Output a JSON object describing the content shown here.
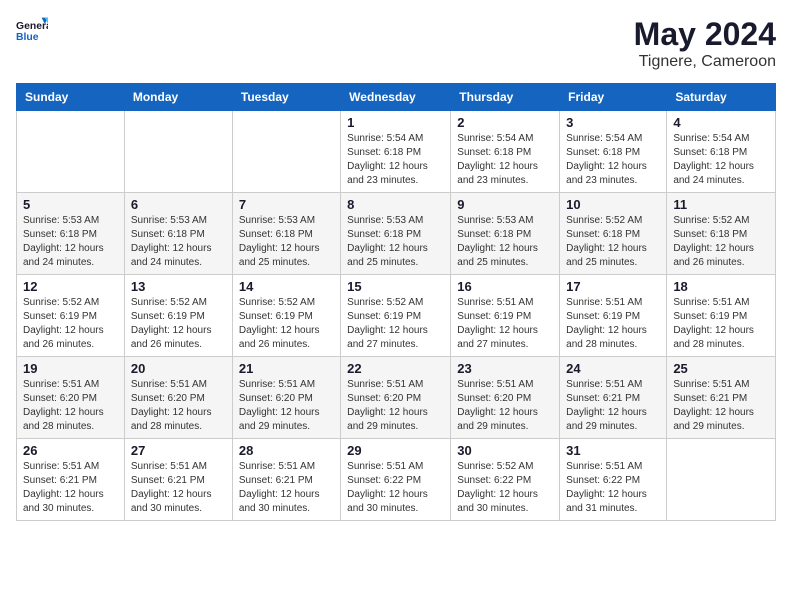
{
  "header": {
    "logo_line1": "General",
    "logo_line2": "Blue",
    "month_year": "May 2024",
    "location": "Tignere, Cameroon"
  },
  "days_of_week": [
    "Sunday",
    "Monday",
    "Tuesday",
    "Wednesday",
    "Thursday",
    "Friday",
    "Saturday"
  ],
  "weeks": [
    [
      {
        "day": "",
        "info": ""
      },
      {
        "day": "",
        "info": ""
      },
      {
        "day": "",
        "info": ""
      },
      {
        "day": "1",
        "info": "Sunrise: 5:54 AM\nSunset: 6:18 PM\nDaylight: 12 hours\nand 23 minutes."
      },
      {
        "day": "2",
        "info": "Sunrise: 5:54 AM\nSunset: 6:18 PM\nDaylight: 12 hours\nand 23 minutes."
      },
      {
        "day": "3",
        "info": "Sunrise: 5:54 AM\nSunset: 6:18 PM\nDaylight: 12 hours\nand 23 minutes."
      },
      {
        "day": "4",
        "info": "Sunrise: 5:54 AM\nSunset: 6:18 PM\nDaylight: 12 hours\nand 24 minutes."
      }
    ],
    [
      {
        "day": "5",
        "info": "Sunrise: 5:53 AM\nSunset: 6:18 PM\nDaylight: 12 hours\nand 24 minutes."
      },
      {
        "day": "6",
        "info": "Sunrise: 5:53 AM\nSunset: 6:18 PM\nDaylight: 12 hours\nand 24 minutes."
      },
      {
        "day": "7",
        "info": "Sunrise: 5:53 AM\nSunset: 6:18 PM\nDaylight: 12 hours\nand 25 minutes."
      },
      {
        "day": "8",
        "info": "Sunrise: 5:53 AM\nSunset: 6:18 PM\nDaylight: 12 hours\nand 25 minutes."
      },
      {
        "day": "9",
        "info": "Sunrise: 5:53 AM\nSunset: 6:18 PM\nDaylight: 12 hours\nand 25 minutes."
      },
      {
        "day": "10",
        "info": "Sunrise: 5:52 AM\nSunset: 6:18 PM\nDaylight: 12 hours\nand 25 minutes."
      },
      {
        "day": "11",
        "info": "Sunrise: 5:52 AM\nSunset: 6:18 PM\nDaylight: 12 hours\nand 26 minutes."
      }
    ],
    [
      {
        "day": "12",
        "info": "Sunrise: 5:52 AM\nSunset: 6:19 PM\nDaylight: 12 hours\nand 26 minutes."
      },
      {
        "day": "13",
        "info": "Sunrise: 5:52 AM\nSunset: 6:19 PM\nDaylight: 12 hours\nand 26 minutes."
      },
      {
        "day": "14",
        "info": "Sunrise: 5:52 AM\nSunset: 6:19 PM\nDaylight: 12 hours\nand 26 minutes."
      },
      {
        "day": "15",
        "info": "Sunrise: 5:52 AM\nSunset: 6:19 PM\nDaylight: 12 hours\nand 27 minutes."
      },
      {
        "day": "16",
        "info": "Sunrise: 5:51 AM\nSunset: 6:19 PM\nDaylight: 12 hours\nand 27 minutes."
      },
      {
        "day": "17",
        "info": "Sunrise: 5:51 AM\nSunset: 6:19 PM\nDaylight: 12 hours\nand 28 minutes."
      },
      {
        "day": "18",
        "info": "Sunrise: 5:51 AM\nSunset: 6:19 PM\nDaylight: 12 hours\nand 28 minutes."
      }
    ],
    [
      {
        "day": "19",
        "info": "Sunrise: 5:51 AM\nSunset: 6:20 PM\nDaylight: 12 hours\nand 28 minutes."
      },
      {
        "day": "20",
        "info": "Sunrise: 5:51 AM\nSunset: 6:20 PM\nDaylight: 12 hours\nand 28 minutes."
      },
      {
        "day": "21",
        "info": "Sunrise: 5:51 AM\nSunset: 6:20 PM\nDaylight: 12 hours\nand 29 minutes."
      },
      {
        "day": "22",
        "info": "Sunrise: 5:51 AM\nSunset: 6:20 PM\nDaylight: 12 hours\nand 29 minutes."
      },
      {
        "day": "23",
        "info": "Sunrise: 5:51 AM\nSunset: 6:20 PM\nDaylight: 12 hours\nand 29 minutes."
      },
      {
        "day": "24",
        "info": "Sunrise: 5:51 AM\nSunset: 6:21 PM\nDaylight: 12 hours\nand 29 minutes."
      },
      {
        "day": "25",
        "info": "Sunrise: 5:51 AM\nSunset: 6:21 PM\nDaylight: 12 hours\nand 29 minutes."
      }
    ],
    [
      {
        "day": "26",
        "info": "Sunrise: 5:51 AM\nSunset: 6:21 PM\nDaylight: 12 hours\nand 30 minutes."
      },
      {
        "day": "27",
        "info": "Sunrise: 5:51 AM\nSunset: 6:21 PM\nDaylight: 12 hours\nand 30 minutes."
      },
      {
        "day": "28",
        "info": "Sunrise: 5:51 AM\nSunset: 6:21 PM\nDaylight: 12 hours\nand 30 minutes."
      },
      {
        "day": "29",
        "info": "Sunrise: 5:51 AM\nSunset: 6:22 PM\nDaylight: 12 hours\nand 30 minutes."
      },
      {
        "day": "30",
        "info": "Sunrise: 5:52 AM\nSunset: 6:22 PM\nDaylight: 12 hours\nand 30 minutes."
      },
      {
        "day": "31",
        "info": "Sunrise: 5:51 AM\nSunset: 6:22 PM\nDaylight: 12 hours\nand 31 minutes."
      },
      {
        "day": "",
        "info": ""
      }
    ]
  ]
}
